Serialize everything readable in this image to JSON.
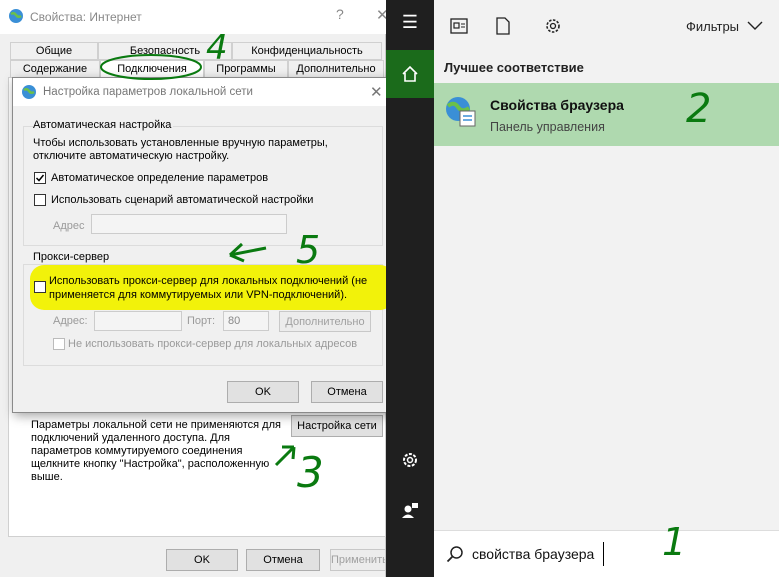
{
  "ie_window": {
    "title": "Свойства: Интернет",
    "help": "?",
    "close": "✕",
    "tabs_row1": [
      "Общие",
      "Безопасность",
      "Конфиденциальность"
    ],
    "tabs_row2": [
      "Содержание",
      "Подключения",
      "Программы",
      "Дополнительно"
    ],
    "lan_info": "Параметры локальной сети не применяются для подключений удаленного доступа. Для параметров коммутируемого соединения щелкните кнопку \"Настройка\", расположенную выше.",
    "lan_settings_button": "Настройка сети",
    "ok": "OK",
    "cancel": "Отмена",
    "apply": "Применить"
  },
  "lan_dialog": {
    "title": "Настройка параметров локальной сети",
    "close": "✕",
    "auto_group": "Автоматическая настройка",
    "auto_desc": "Чтобы использовать установленные вручную параметры, отключите автоматическую настройку.",
    "auto_detect_label": "Автоматическое определение параметров",
    "auto_detect_checked": true,
    "script_label": "Использовать сценарий автоматической настройки",
    "script_checked": false,
    "address_label": "Адрес",
    "proxy_group": "Прокси-сервер",
    "proxy_label_line1": "Использовать прокси-сервер для локальных подключений (не",
    "proxy_label_line2": "применяется для коммутируемых или VPN-подключений).",
    "proxy_checked": false,
    "proxy_address_label": "Адрес:",
    "port_label": "Порт:",
    "port_value": "80",
    "advanced_button": "Дополнительно",
    "bypass_label": "Не использовать прокси-сервер для локальных адресов",
    "ok": "OK",
    "cancel": "Отмена"
  },
  "search": {
    "filters": "Фильтры",
    "best_match": "Лучшее соответствие",
    "result_title": "Свойства браузера",
    "result_subtitle": "Панель управления",
    "query": "свойства браузера"
  },
  "annotations": [
    "1",
    "2",
    "3",
    "4",
    "5"
  ],
  "colors": {
    "highlight": "#f2f20a",
    "annotation": "#0a7a10",
    "result_bg": "#afd9af",
    "rail_home": "#1b6b1b"
  }
}
